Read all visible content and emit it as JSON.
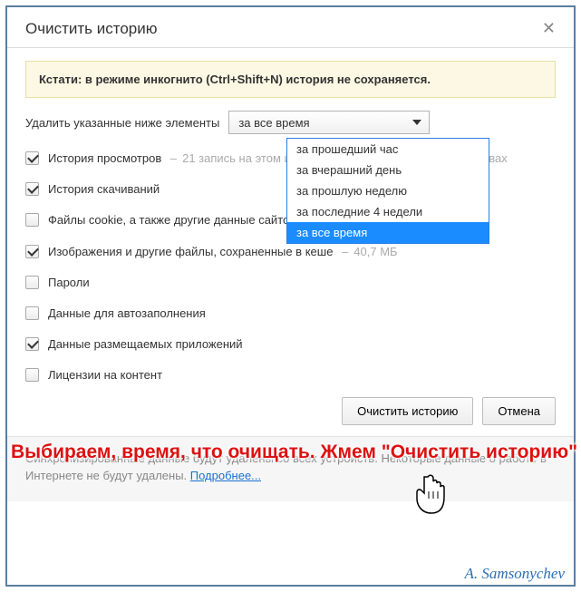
{
  "title": "Очистить историю",
  "close_glyph": "✕",
  "notice": {
    "prefix": "Кстати: ",
    "text": "в режиме инкогнито (Ctrl+Shift+N) история не сохраняется."
  },
  "range": {
    "label": "Удалить указанные ниже элементы",
    "selected": "за все время",
    "options": [
      "за прошедший час",
      "за вчерашний день",
      "за прошлую неделю",
      "за последние 4 недели",
      "за все время"
    ],
    "highlight_index": 4
  },
  "items": [
    {
      "checked": true,
      "label": "История просмотров",
      "sub": "21 запись на этом и других синхронизируемых устройствах"
    },
    {
      "checked": true,
      "label": "История скачиваний",
      "sub": ""
    },
    {
      "checked": false,
      "label": "Файлы cookie, а также другие данные сайтов и плагинов",
      "sub": ""
    },
    {
      "checked": true,
      "label": "Изображения и другие файлы, сохраненные в кеше",
      "sub": "40,7 МБ"
    },
    {
      "checked": false,
      "label": "Пароли",
      "sub": ""
    },
    {
      "checked": false,
      "label": "Данные для автозаполнения",
      "sub": ""
    },
    {
      "checked": true,
      "label": "Данные размещаемых приложений",
      "sub": ""
    },
    {
      "checked": false,
      "label": "Лицензии на контент",
      "sub": ""
    }
  ],
  "buttons": {
    "ok": "Очистить историю",
    "cancel": "Отмена"
  },
  "footer": {
    "text": "Синхронизированные данные будут удалены со всех устройств. Некоторые данные о работе в Интернете не будут удалены. ",
    "link": "Подробнее..."
  },
  "overlay": "Выбираем, время, что очищать. Жмем \"Очистить историю\"",
  "signature": "A. Samsonychev"
}
